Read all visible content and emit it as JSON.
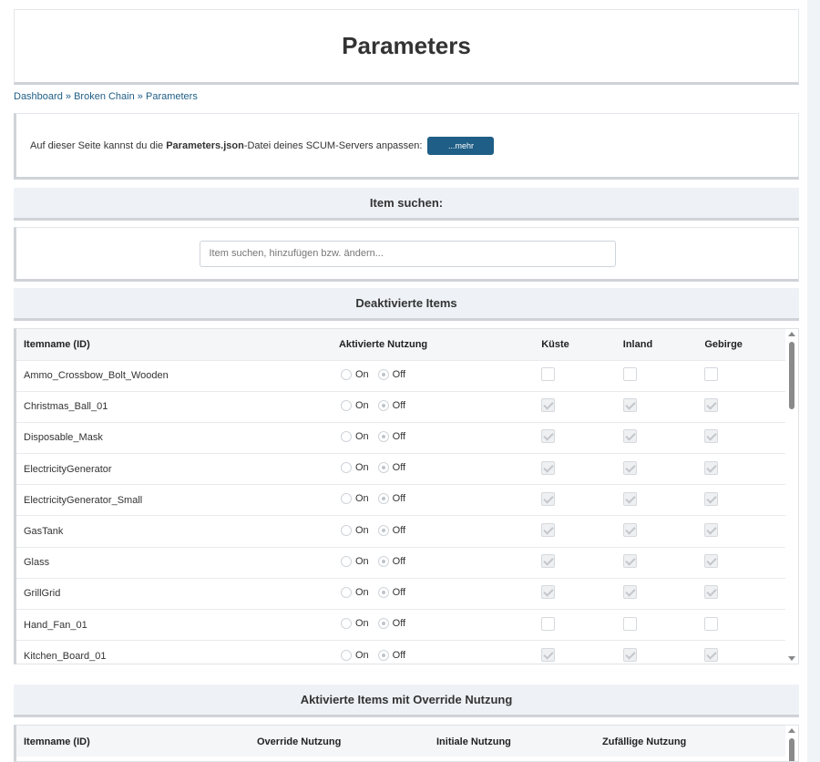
{
  "page_title": "Parameters",
  "breadcrumb": [
    "Dashboard",
    "Broken Chain",
    "Parameters"
  ],
  "breadcrumb_sep": "»",
  "info": {
    "text_before": "Auf dieser Seite kannst du die ",
    "bold": "Parameters.json",
    "text_after": "-Datei deines SCUM-Servers anpassen:",
    "button": "...mehr"
  },
  "search": {
    "heading": "Item suchen:",
    "placeholder": "Item suchen, hinzufügen bzw. ändern..."
  },
  "deactivated": {
    "heading": "Deaktivierte Items",
    "columns": [
      "Itemname (ID)",
      "Aktivierte Nutzung",
      "Küste",
      "Inland",
      "Gebirge"
    ],
    "radio_on": "On",
    "radio_off": "Off",
    "rows": [
      {
        "name": "Ammo_Crossbow_Bolt_Wooden",
        "checked": [
          false,
          false,
          false
        ]
      },
      {
        "name": "Christmas_Ball_01",
        "checked": [
          true,
          true,
          true
        ]
      },
      {
        "name": "Disposable_Mask",
        "checked": [
          true,
          true,
          true
        ]
      },
      {
        "name": "ElectricityGenerator",
        "checked": [
          true,
          true,
          true
        ]
      },
      {
        "name": "ElectricityGenerator_Small",
        "checked": [
          true,
          true,
          true
        ]
      },
      {
        "name": "GasTank",
        "checked": [
          true,
          true,
          true
        ]
      },
      {
        "name": "Glass",
        "checked": [
          true,
          true,
          true
        ]
      },
      {
        "name": "GrillGrid",
        "checked": [
          true,
          true,
          true
        ]
      },
      {
        "name": "Hand_Fan_01",
        "checked": [
          false,
          false,
          false
        ]
      },
      {
        "name": "Kitchen_Board_01",
        "checked": [
          true,
          true,
          true
        ]
      }
    ]
  },
  "override": {
    "heading": "Aktivierte Items mit Override Nutzung",
    "columns": [
      "Itemname (ID)",
      "Override Nutzung",
      "Initiale Nutzung",
      "Zufällige Nutzung"
    ]
  }
}
